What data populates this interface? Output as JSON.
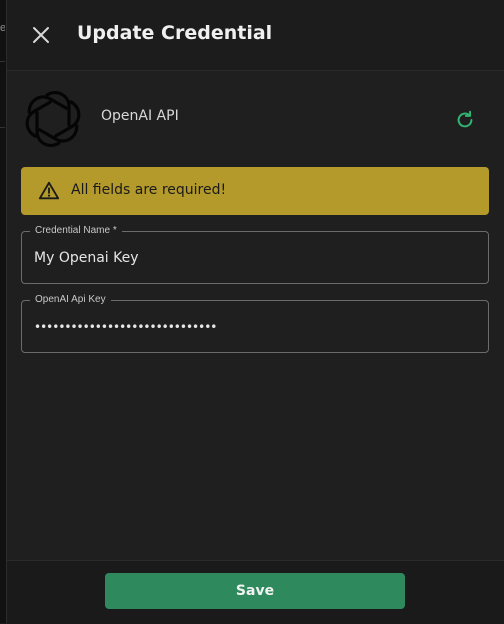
{
  "dialog": {
    "title": "Update Credential"
  },
  "provider": {
    "name": "OpenAI API",
    "logo_icon": "openai-logo",
    "refresh_icon": "refresh-icon",
    "accent": "#2fb56f"
  },
  "alert": {
    "message": "All fields are required!",
    "background": "#b49a2a",
    "icon": "warning-triangle-icon"
  },
  "fields": [
    {
      "label": "Credential Name *",
      "value": "My Openai Key",
      "type": "text"
    },
    {
      "label": "OpenAI Api Key",
      "value": "••••••••••••••••••••••••••••••",
      "type": "password"
    }
  ],
  "footer": {
    "save_label": "Save",
    "save_color": "#2e8a5c"
  },
  "backdrop": {
    "fragment": "e"
  }
}
